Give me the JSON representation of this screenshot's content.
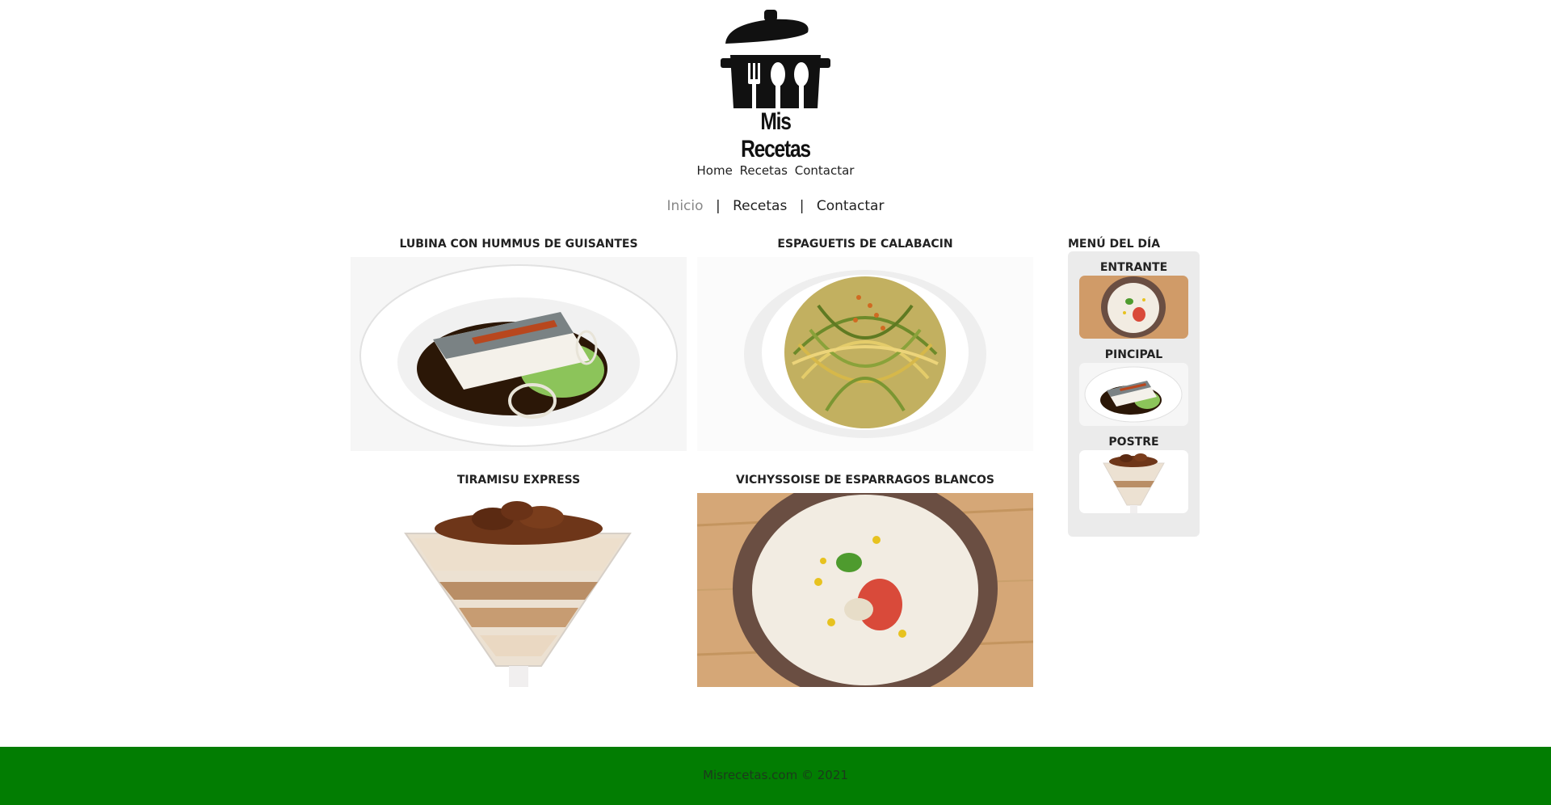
{
  "brand": {
    "logo_text": "Mis Recetas"
  },
  "top_nav": {
    "items": [
      {
        "label": "Home"
      },
      {
        "label": "Recetas"
      },
      {
        "label": "Contactar"
      }
    ]
  },
  "main_nav": {
    "items": [
      {
        "label": "Inicio",
        "active": true
      },
      {
        "label": "Recetas",
        "active": false
      },
      {
        "label": "Contactar",
        "active": false
      }
    ],
    "separator": "|"
  },
  "recipes": [
    {
      "title": "LUBINA CON HUMMUS DE GUISANTES",
      "image": "sea-bass-dish"
    },
    {
      "title": "ESPAGUETIS DE CALABACIN",
      "image": "zucchini-spaghetti"
    },
    {
      "title": "TIRAMISU EXPRESS",
      "image": "tiramisu-glass"
    },
    {
      "title": "VICHYSSOISE DE ESPARRAGOS BLANCOS",
      "image": "asparagus-soup"
    }
  ],
  "daily_menu": {
    "heading": "MENÚ DEL DÍA",
    "items": [
      {
        "label": "ENTRANTE",
        "image": "asparagus-soup"
      },
      {
        "label": "PINCIPAL",
        "image": "sea-bass-dish"
      },
      {
        "label": "POSTRE",
        "image": "tiramisu-glass"
      }
    ]
  },
  "footer": {
    "text": "Misrecetas.com © 2021"
  },
  "colors": {
    "footer_bg": "#027d02",
    "panel_bg": "#ebebeb",
    "active_nav": "#888888"
  }
}
